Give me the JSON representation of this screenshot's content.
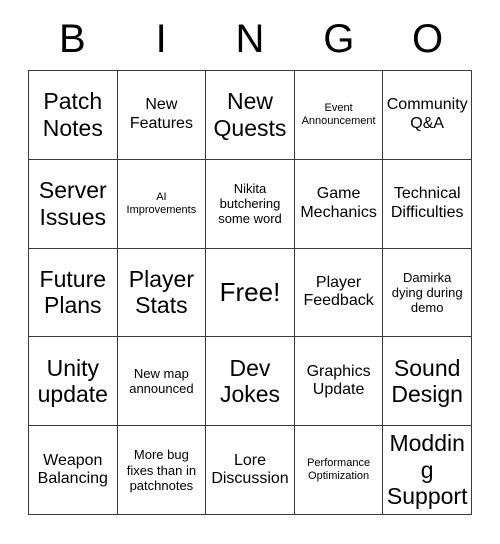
{
  "card": {
    "header_letters": [
      "B",
      "I",
      "N",
      "G",
      "O"
    ],
    "columns": 5,
    "rows": 5,
    "border_color": "#3a3a3a",
    "background_color": "#ffffff",
    "text_color": "#000000",
    "cells": [
      {
        "text": "Patch Notes",
        "size": "lg",
        "free": false
      },
      {
        "text": "New Features",
        "size": "md",
        "free": false
      },
      {
        "text": "New Quests",
        "size": "lg",
        "free": false
      },
      {
        "text": "Event Announcement",
        "size": "xs",
        "free": false
      },
      {
        "text": "Community Q&A",
        "size": "md",
        "free": false
      },
      {
        "text": "Server Issues",
        "size": "lg",
        "free": false
      },
      {
        "text": "AI Improvements",
        "size": "xs",
        "free": false
      },
      {
        "text": "Nikita butchering some word",
        "size": "sm",
        "free": false
      },
      {
        "text": "Game Mechanics",
        "size": "md",
        "free": false
      },
      {
        "text": "Technical Difficulties",
        "size": "md",
        "free": false
      },
      {
        "text": "Future Plans",
        "size": "lg",
        "free": false
      },
      {
        "text": "Player Stats",
        "size": "lg",
        "free": false
      },
      {
        "text": "Free!",
        "size": "xl",
        "free": true
      },
      {
        "text": "Player Feedback",
        "size": "md",
        "free": false
      },
      {
        "text": "Damirka dying during demo",
        "size": "sm",
        "free": false
      },
      {
        "text": "Unity update",
        "size": "lg",
        "free": false
      },
      {
        "text": "New map announced",
        "size": "sm",
        "free": false
      },
      {
        "text": "Dev Jokes",
        "size": "lg",
        "free": false
      },
      {
        "text": "Graphics Update",
        "size": "md",
        "free": false
      },
      {
        "text": "Sound Design",
        "size": "lg",
        "free": false
      },
      {
        "text": "Weapon Balancing",
        "size": "md",
        "free": false
      },
      {
        "text": "More bug fixes than in patchnotes",
        "size": "sm",
        "free": false
      },
      {
        "text": "Lore Discussion",
        "size": "md",
        "free": false
      },
      {
        "text": "Performance Optimization",
        "size": "xs",
        "free": false
      },
      {
        "text": "Modding Support",
        "size": "lg",
        "free": false
      }
    ]
  }
}
